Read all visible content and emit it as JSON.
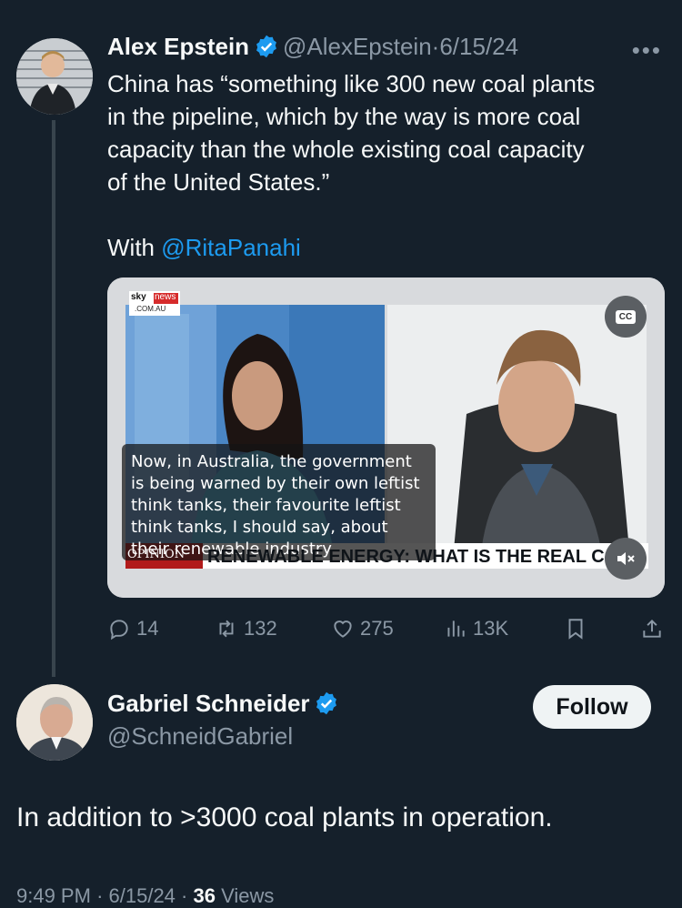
{
  "tweet": {
    "author_name": "Alex Epstein",
    "handle": "@AlexEpstein",
    "separator": "·",
    "date": "6/15/24",
    "more_label": "•••",
    "text_lines": [
      "China has “something like 300 new coal plants",
      "in the pipeline, which by the way is more coal",
      "capacity than the whole existing coal capacity",
      "of the United States.”"
    ],
    "with_label": "With",
    "mention": "@RitaPanahi",
    "media": {
      "logo_top": "sky",
      "logo_news": "news",
      "logo_sub": ".COM.AU",
      "cc_label": "CC",
      "caption": "Now, in Australia, the government is being warned by their own leftist think tanks, their favourite leftist think tanks, I should say, about their renewable industry",
      "opinion_tag": "OPINION",
      "ticker": "RENEWABLE ENERGY: WHAT IS THE REAL COS"
    },
    "stats": {
      "replies": "14",
      "reposts": "132",
      "likes": "275",
      "views": "13K"
    }
  },
  "reply": {
    "author_name": "Gabriel Schneider",
    "handle": "@SchneidGabriel",
    "follow_label": "Follow",
    "text": "In addition to >3000 coal plants in operation.",
    "time": "9:49 PM",
    "date": "6/15/24",
    "views_count": "36",
    "views_label": "Views"
  },
  "colors": {
    "background": "#15202b",
    "accent": "#1d9bf0",
    "muted": "#8b98a5"
  },
  "icons": [
    "verified-badge-icon",
    "more-icon",
    "reply-icon",
    "repost-icon",
    "like-icon",
    "views-icon",
    "bookmark-icon",
    "share-icon",
    "closed-captions-icon",
    "mute-icon"
  ]
}
